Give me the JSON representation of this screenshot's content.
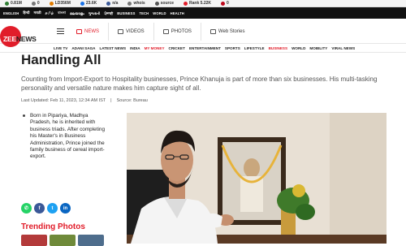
{
  "seo_bar": {
    "items": [
      {
        "label": "0.81M",
        "color": "#2f7d32"
      },
      {
        "label": "0",
        "color": "#777777"
      },
      {
        "label": "LD356M",
        "color": "#e07b00"
      },
      {
        "label": "23.6K",
        "color": "#1a73e8"
      },
      {
        "label": "n/a",
        "color": "#3b5998"
      },
      {
        "label": "whois",
        "color": "#777777"
      },
      {
        "label": "source",
        "color": "#555555"
      },
      {
        "label": "Rank 5.22K",
        "color": "#e11d2a"
      },
      {
        "label": "0",
        "color": "#bd081c"
      }
    ]
  },
  "top_nav": {
    "items": [
      "ENGLISH",
      "हिन्दी",
      "मराठी",
      "தமிழ்",
      "বাংলা",
      "മലയാളം",
      "ગુજરાતી",
      "ਪੰਜਾਬੀ",
      "BUSINESS",
      "TECH",
      "WORLD",
      "HEALTH"
    ]
  },
  "header": {
    "logo_zee": "ZEE",
    "logo_news": "NEWS",
    "tabs": [
      {
        "label": "NEWS",
        "active": true
      },
      {
        "label": "VIDEOS",
        "active": false
      },
      {
        "label": "PHOTOS",
        "active": false
      },
      {
        "label": "Web Stories",
        "active": false
      }
    ]
  },
  "category_nav": {
    "items": [
      {
        "label": "LIVE TV",
        "active": false
      },
      {
        "label": "ADANI SAGA",
        "active": false
      },
      {
        "label": "LATEST NEWS",
        "active": false
      },
      {
        "label": "INDIA",
        "active": false
      },
      {
        "label": "MY MONEY",
        "active": true
      },
      {
        "label": "CRICKET",
        "active": false
      },
      {
        "label": "ENTERTAINMENT",
        "active": false
      },
      {
        "label": "SPORTS",
        "active": false
      },
      {
        "label": "LIFESTYLE",
        "active": false
      },
      {
        "label": "BUSINESS",
        "active": true
      },
      {
        "label": "WORLD",
        "active": false
      },
      {
        "label": "MOBILITY",
        "active": false
      },
      {
        "label": "VIRAL NEWS",
        "active": false
      }
    ]
  },
  "article": {
    "headline": "Handling All",
    "summary": "Counting from Import-Export to Hospitality businesses, Prince Khanuja is part of more than six businesses. His multi-tasking personality and versatile nature makes him capture sight of all.",
    "last_updated": "Last Updated: Feb 11, 2023, 12:34 AM IST",
    "separator": "|",
    "source": "Source: Bureau",
    "bio": "Born in Pipariya, Madhya Pradesh, he is inherited with business triads. After completing his Master's in Business Administration, Prince joined the family business of cereal import-export."
  },
  "share": {
    "buttons": [
      {
        "name": "whatsapp",
        "glyph": "✆",
        "color": "#25d366"
      },
      {
        "name": "facebook",
        "glyph": "f",
        "color": "#3b5998"
      },
      {
        "name": "twitter",
        "glyph": "t",
        "color": "#1da1f2"
      },
      {
        "name": "linkedin",
        "glyph": "in",
        "color": "#0a66c2"
      }
    ]
  },
  "trending": {
    "title": "Trending Photos"
  }
}
